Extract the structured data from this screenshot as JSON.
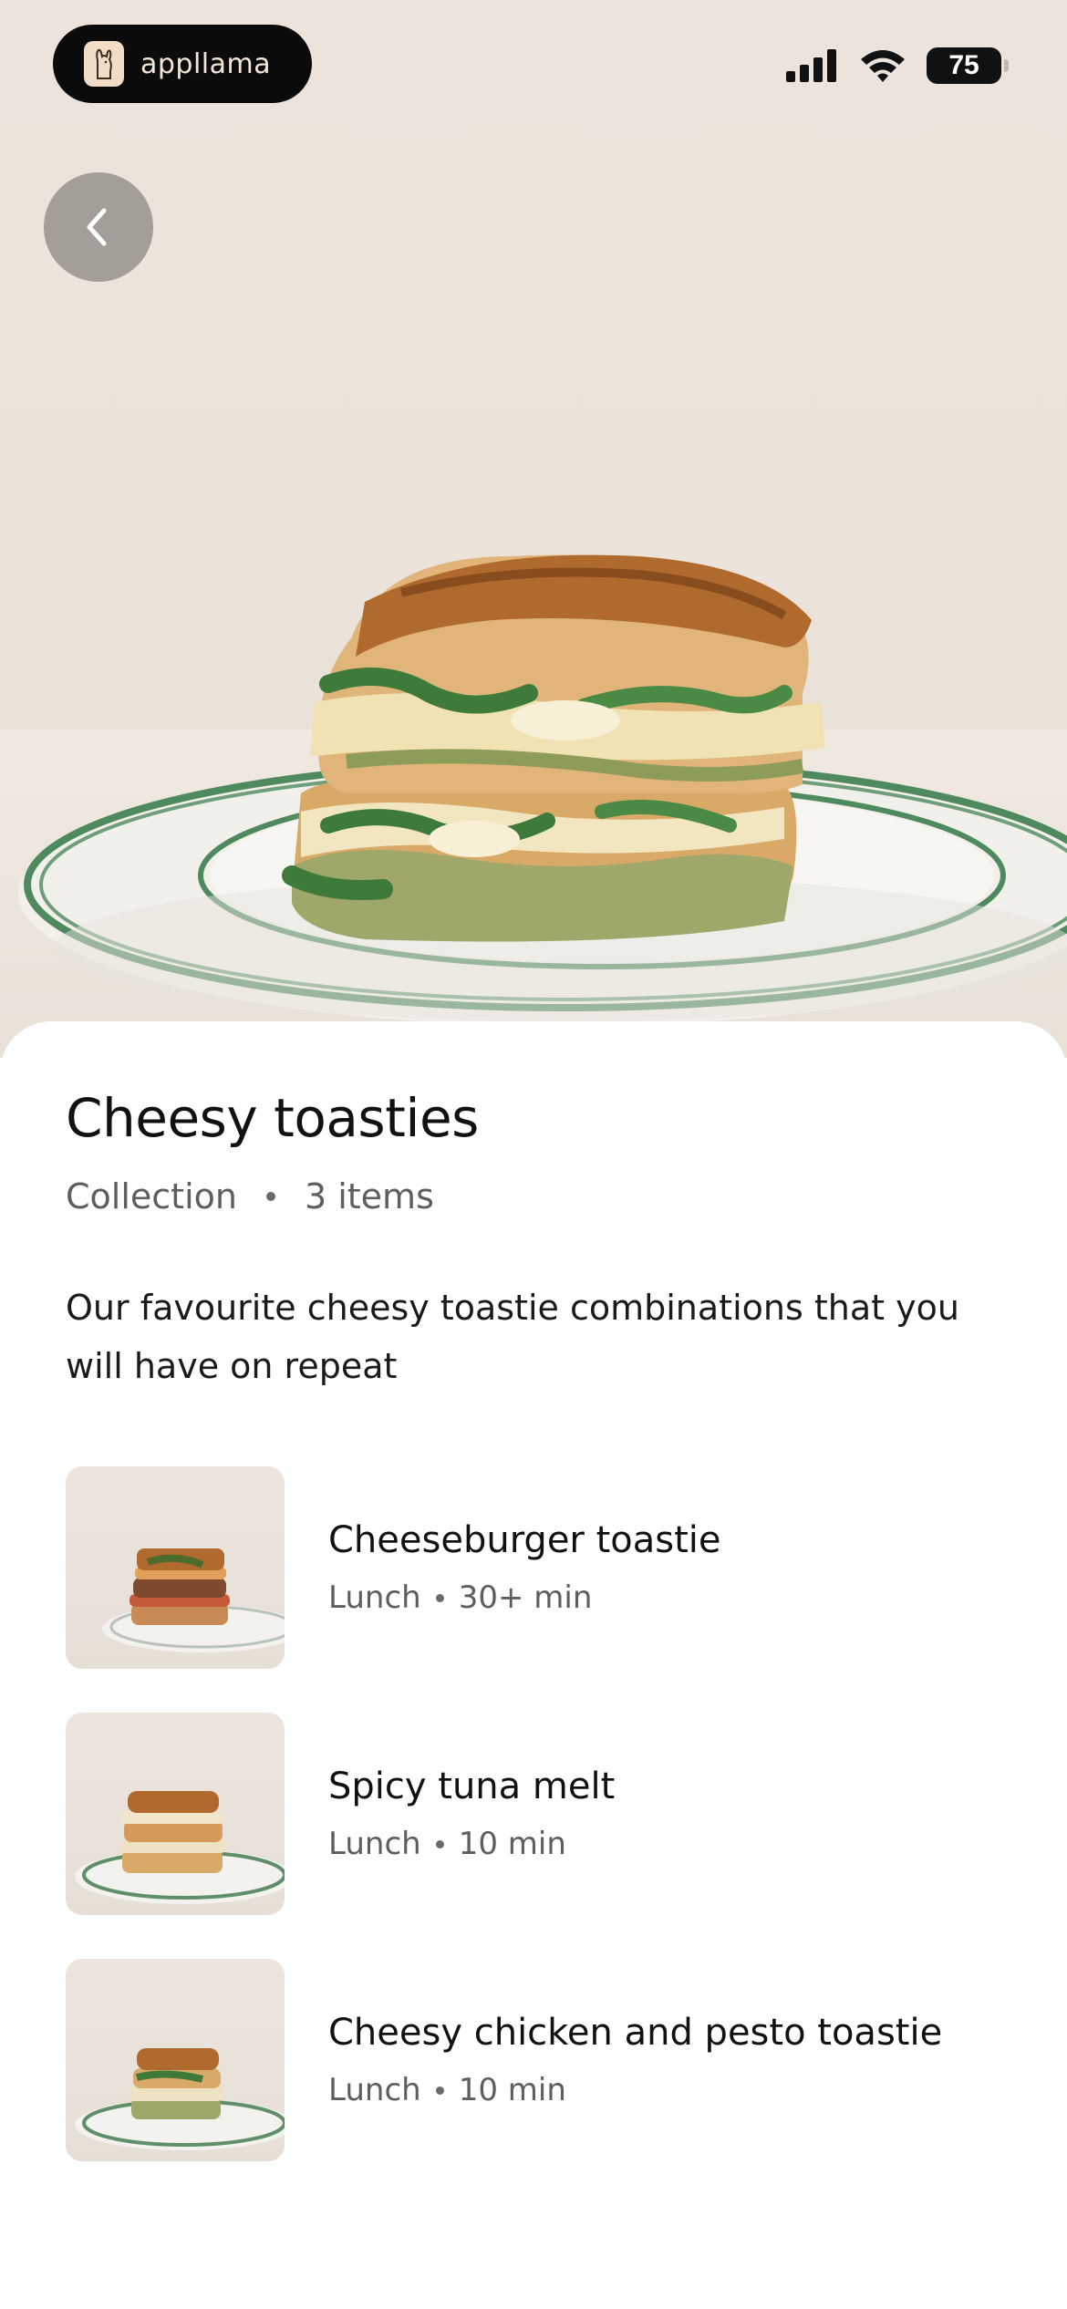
{
  "status_bar": {
    "app_badge": "appllama",
    "battery": "75"
  },
  "collection": {
    "title": "Cheesy toasties",
    "type": "Collection",
    "count": "3 items",
    "description": "Our favourite cheesy toastie combinations that you will have on repeat"
  },
  "recipes": [
    {
      "title": "Cheeseburger toastie",
      "meal": "Lunch",
      "time": "30+ min"
    },
    {
      "title": "Spicy tuna melt",
      "meal": "Lunch",
      "time": "10 min"
    },
    {
      "title": "Cheesy chicken and pesto toastie",
      "meal": "Lunch",
      "time": "10 min"
    }
  ],
  "icons": {
    "back": "chevron-left-icon",
    "signal": "cellular-signal-icon",
    "wifi": "wifi-icon",
    "battery": "battery-icon",
    "logo": "llama-logo-icon"
  },
  "colors": {
    "sheet_background": "#ffffff",
    "title_text": "#111111",
    "secondary_text": "#5e5e5e",
    "plate_rim_green": "#4f8a5e"
  }
}
